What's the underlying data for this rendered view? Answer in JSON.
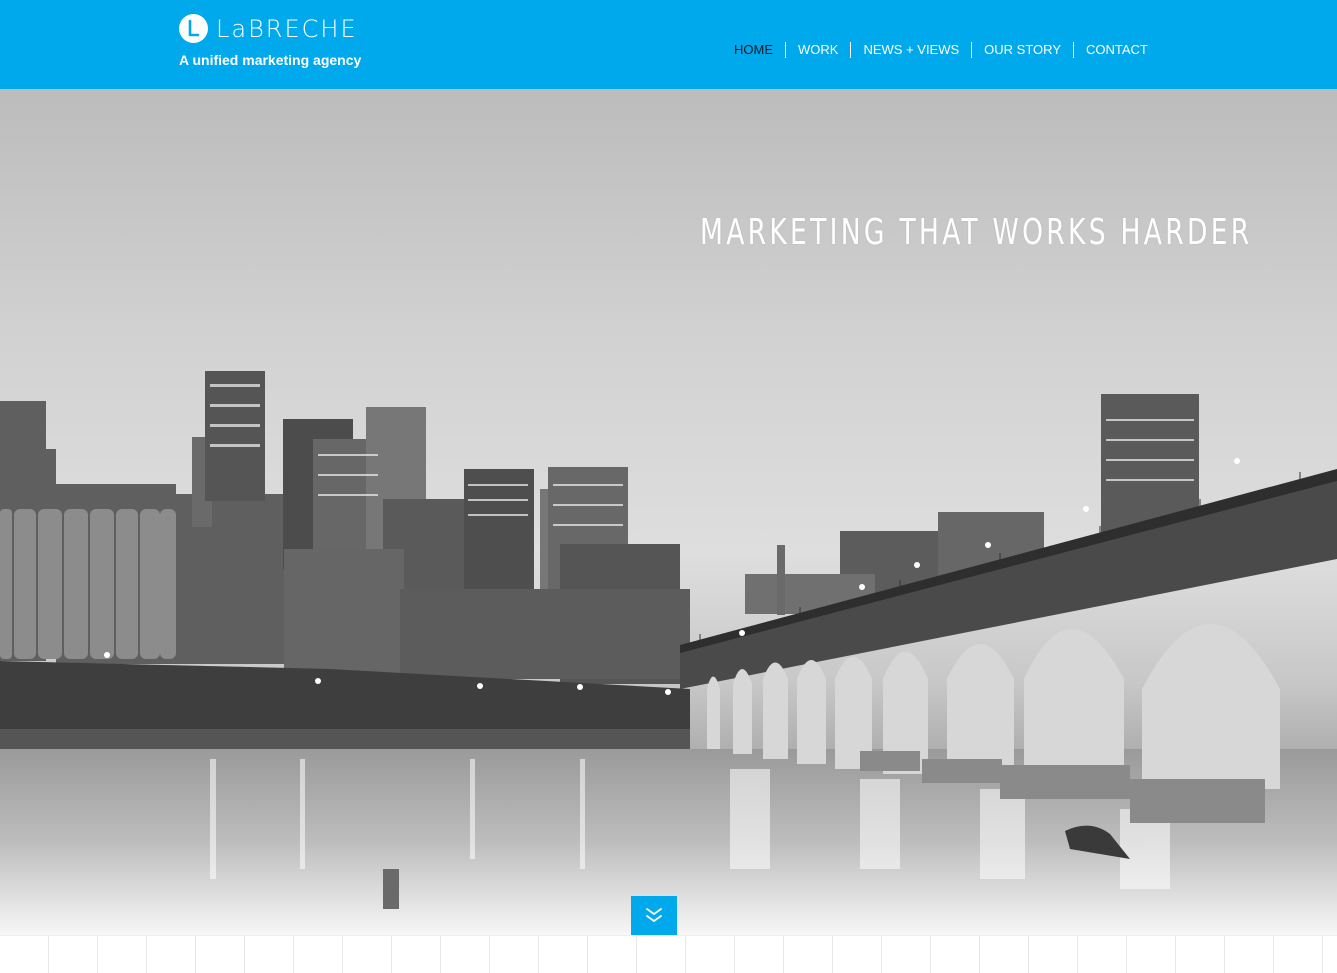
{
  "header": {
    "brand": "LaBRECHE",
    "tagline": "A unified marketing agency",
    "logo_icon": "L",
    "background_color": "#00a9ec"
  },
  "nav": {
    "items": [
      {
        "label": "HOME",
        "active": true
      },
      {
        "label": "WORK",
        "active": false
      },
      {
        "label": "NEWS + VIEWS",
        "active": false
      },
      {
        "label": "OUR STORY",
        "active": false
      },
      {
        "label": "CONTACT",
        "active": false
      }
    ]
  },
  "hero": {
    "headline": "MARKETING THAT WORKS HARDER",
    "image": "black-and-white-city-skyline-stone-arch-bridge",
    "scroll_icon": "double-chevron-down-icon"
  },
  "colors": {
    "accent": "#00a9ec",
    "active_nav_text": "#0b1a24"
  }
}
